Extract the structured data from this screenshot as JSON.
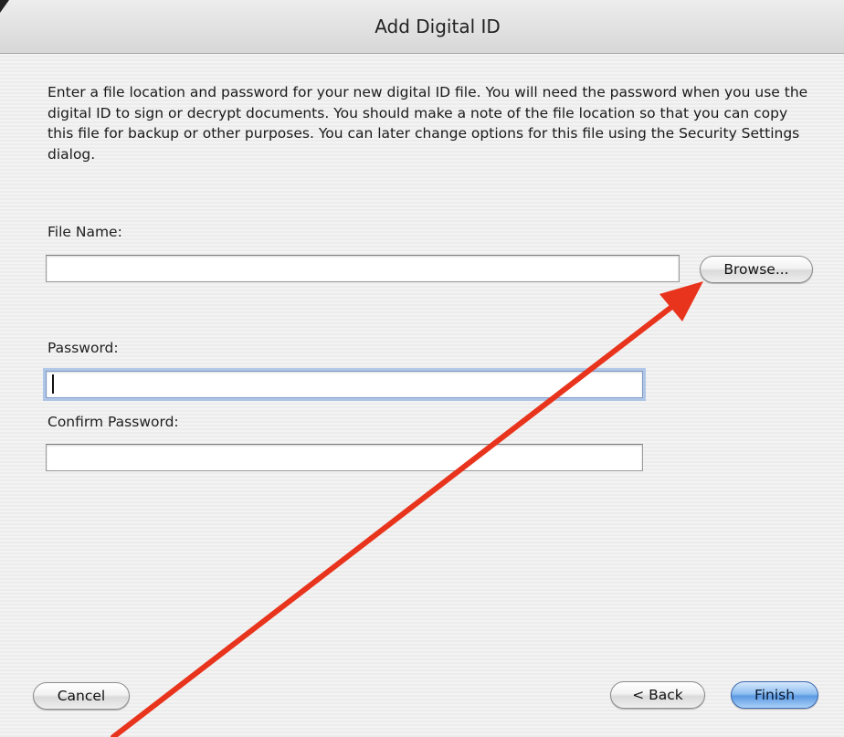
{
  "window": {
    "title": "Add Digital ID"
  },
  "description": "Enter a file location and password for your new digital ID file. You will need the password when you use the digital ID to sign or decrypt documents. You should make a note of the file location so that you can copy this file for backup or other purposes. You can later change options for this file using the Security Settings dialog.",
  "form": {
    "file_name_label": "File Name:",
    "file_name_value": "",
    "browse_label": "Browse...",
    "password_label": "Password:",
    "password_value": "",
    "confirm_password_label": "Confirm Password:",
    "confirm_password_value": ""
  },
  "buttons": {
    "cancel": "Cancel",
    "back": "< Back",
    "finish": "Finish"
  },
  "colors": {
    "annotation_arrow": "#e8341c",
    "focus_ring": "#7ca4de",
    "default_button": "#5c9ae3"
  },
  "icons": {
    "annotation": "red-arrow-pointing-to-browse"
  }
}
